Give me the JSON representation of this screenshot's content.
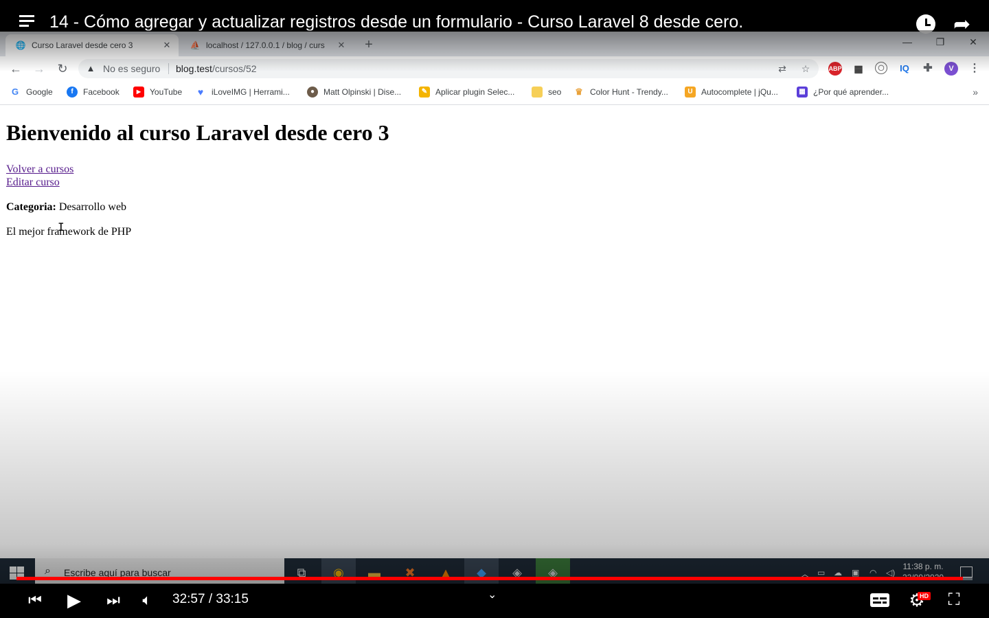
{
  "youtube": {
    "video_title": "14 - Cómo agregar y actualizar registros desde un formulario - Curso Laravel 8 desde cero.",
    "time_display": "32:57 / 33:15",
    "progress": 0.99,
    "hd_badge": "HD",
    "icons": [
      "menu-icon",
      "watch-later-icon",
      "share-icon",
      "previous-icon",
      "play-icon",
      "next-icon",
      "volume-icon",
      "subtitles-icon",
      "settings-icon",
      "exit-fullscreen-icon"
    ]
  },
  "browser": {
    "tabs": [
      {
        "title": "Curso Laravel desde cero 3",
        "active": true
      },
      {
        "title": "localhost / 127.0.0.1 / blog / curs",
        "active": false
      }
    ],
    "security_label": "No es seguro",
    "url_host": "blog.test",
    "url_path": "/cursos/52",
    "profile_initial": "V",
    "ext_abp": "ABP",
    "ext_iq": "IQ",
    "bookmarks": [
      {
        "label": "Google",
        "color": "#4285f4",
        "glyph": "G"
      },
      {
        "label": "Facebook",
        "color": "#1877f2",
        "glyph": "f"
      },
      {
        "label": "YouTube",
        "color": "#ff0000",
        "glyph": "▶"
      },
      {
        "label": "iLoveIMG | Herrami...",
        "color": "#4a7cff",
        "glyph": "♥"
      },
      {
        "label": "Matt Olpinski | Dise...",
        "color": "#6d5c4a",
        "glyph": "●"
      },
      {
        "label": "Aplicar plugin Selec...",
        "color": "#f4b400",
        "glyph": "✎"
      },
      {
        "label": "seo",
        "color": "#f6cf57",
        "glyph": ""
      },
      {
        "label": "Color Hunt - Trendy...",
        "color": "#e9a23b",
        "glyph": "♛"
      },
      {
        "label": "Autocomplete | jQu...",
        "color": "#f5a623",
        "glyph": "U"
      },
      {
        "label": "¿Por qué aprender...",
        "color": "#5b3fd9",
        "glyph": "▦"
      }
    ]
  },
  "page": {
    "heading": "Bienvenido al curso Laravel desde cero 3",
    "link_back": "Volver a cursos",
    "link_edit": "Editar curso",
    "category_label": "Categoria:",
    "category_value": " Desarrollo web",
    "description": "El mejor framework de PHP"
  },
  "taskbar": {
    "search_placeholder": "Escribe aquí para buscar",
    "time": "11:38 p. m.",
    "date": "22/09/2020"
  }
}
